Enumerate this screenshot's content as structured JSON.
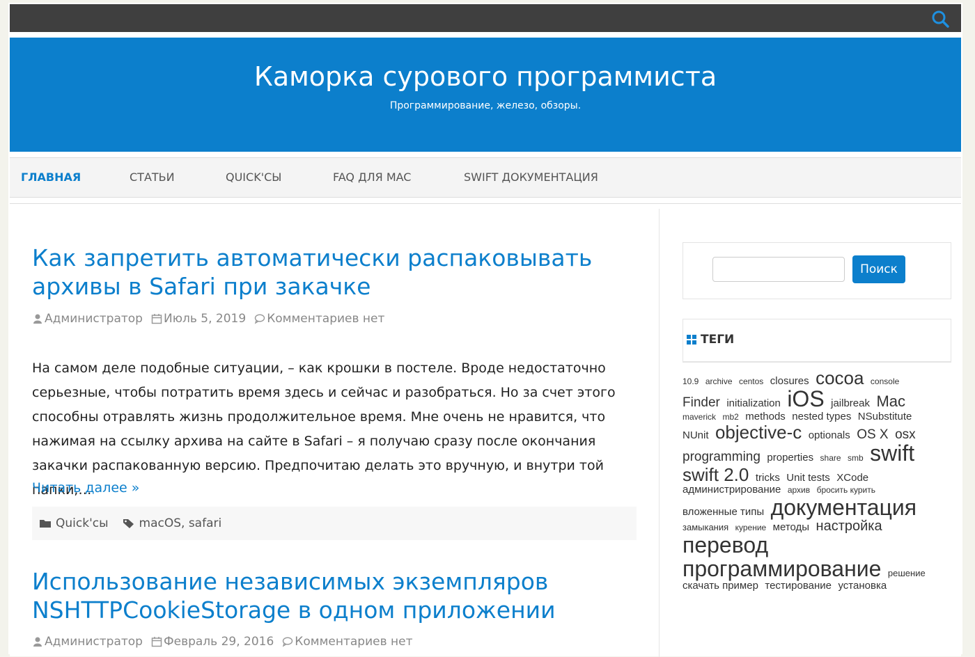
{
  "header": {
    "site_title": "Каморка сурового программиста",
    "site_description": "Программирование, железо, обзоры."
  },
  "nav": {
    "items": [
      {
        "label": "ГЛАВНАЯ",
        "active": true
      },
      {
        "label": "СТАТЬИ",
        "active": false
      },
      {
        "label": "QUICK'СЫ",
        "active": false
      },
      {
        "label": "FAQ ДЛЯ MAC",
        "active": false
      },
      {
        "label": "SWIFT ДОКУМЕНТАЦИЯ",
        "active": false
      }
    ]
  },
  "posts": [
    {
      "title": "Как запретить автоматически распаковывать архивы в Safari при закачке",
      "author": "Администратор",
      "date": "Июль 5, 2019",
      "comments": "Комментариев нет",
      "excerpt": "На самом деле подобные ситуации, – как крошки в постеле. Вроде недостаточно серьезные, чтобы потратить время здесь и сейчас и разобраться. Но за счет этого способны отравлять жизнь продолжительное время. Мне очень не нравится, что нажимая на ссылку архива на сайте в Safari – я получаю сразу после окончания закачки распакованную версию. Предпочитаю делать это вручную, и внутри той папки,…",
      "read_more": "Читать далее »",
      "category": "Quick'сы",
      "tags": "macOS, safari"
    },
    {
      "title": "Использование независимых экземпляров NSHTTPCookieStorage в одном приложении",
      "author": "Администратор",
      "date": "Февраль 29, 2016",
      "comments": "Комментариев нет"
    }
  ],
  "sidebar": {
    "search_button": "Поиск",
    "search_value": "",
    "tags_title": "ТЕГИ",
    "tags": [
      {
        "label": "10.9",
        "size": 12
      },
      {
        "label": "archive",
        "size": 12
      },
      {
        "label": "centos",
        "size": 12
      },
      {
        "label": "closures",
        "size": 15
      },
      {
        "label": "cocoa",
        "size": 26
      },
      {
        "label": "console",
        "size": 12
      },
      {
        "label": "Finder",
        "size": 19
      },
      {
        "label": "initialization",
        "size": 15
      },
      {
        "label": "iOS",
        "size": 32
      },
      {
        "label": "jailbreak",
        "size": 15
      },
      {
        "label": "Mac",
        "size": 22
      },
      {
        "label": "maverick",
        "size": 12
      },
      {
        "label": "mb2",
        "size": 12
      },
      {
        "label": "methods",
        "size": 15
      },
      {
        "label": "nested types",
        "size": 15
      },
      {
        "label": "NSubstitute",
        "size": 15
      },
      {
        "label": "NUnit",
        "size": 15
      },
      {
        "label": "objective-c",
        "size": 26
      },
      {
        "label": "optionals",
        "size": 15
      },
      {
        "label": "OS X",
        "size": 19
      },
      {
        "label": "osx programming",
        "size": 19
      },
      {
        "label": "properties",
        "size": 15
      },
      {
        "label": "share",
        "size": 12
      },
      {
        "label": "smb",
        "size": 12
      },
      {
        "label": "swift",
        "size": 32
      },
      {
        "label": "swift 2.0",
        "size": 26
      },
      {
        "label": "tricks",
        "size": 15
      },
      {
        "label": "Unit tests",
        "size": 15
      },
      {
        "label": "XCode",
        "size": 15
      },
      {
        "label": "администрирование",
        "size": 15
      },
      {
        "label": "архив",
        "size": 12
      },
      {
        "label": "бросить курить",
        "size": 12
      },
      {
        "label": "вложенные типы",
        "size": 15
      },
      {
        "label": "документация",
        "size": 32
      },
      {
        "label": "замыкания",
        "size": 13
      },
      {
        "label": "курение",
        "size": 12
      },
      {
        "label": "методы",
        "size": 15
      },
      {
        "label": "настройка",
        "size": 20
      },
      {
        "label": "перевод",
        "size": 32
      },
      {
        "label": "программирование",
        "size": 32
      },
      {
        "label": "решение",
        "size": 13
      },
      {
        "label": "скачать пример",
        "size": 15
      },
      {
        "label": "тестирование",
        "size": 15
      },
      {
        "label": "установка",
        "size": 15
      }
    ]
  },
  "colors": {
    "accent": "#0c7fcc",
    "topbar": "#3f3f3f"
  }
}
